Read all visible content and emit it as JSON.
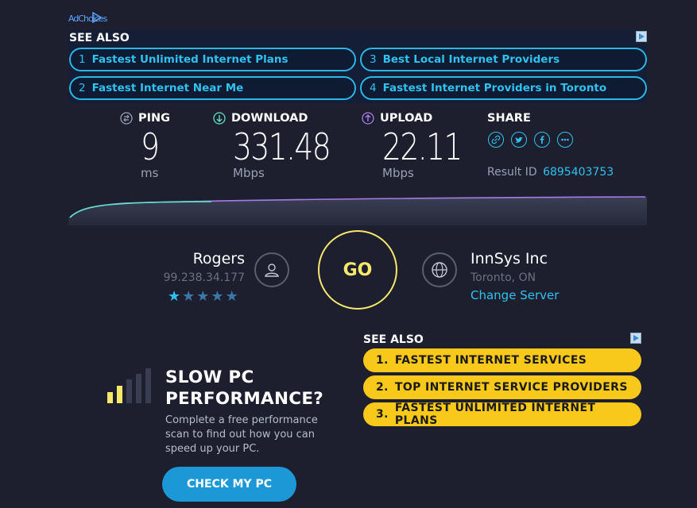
{
  "ad_top": {
    "adchoices_label": "AdChoices",
    "see_also": "SEE ALSO",
    "links": [
      {
        "num": "1",
        "label": "Fastest Unlimited Internet Plans"
      },
      {
        "num": "2",
        "label": "Fastest Internet Near Me"
      },
      {
        "num": "3",
        "label": "Best Local Internet Providers"
      },
      {
        "num": "4",
        "label": "Fastest Internet Providers in Toronto"
      }
    ]
  },
  "results": {
    "ping": {
      "label": "PING",
      "value": "9",
      "unit": "ms"
    },
    "download": {
      "label": "DOWNLOAD",
      "value": "331.48",
      "unit": "Mbps"
    },
    "upload": {
      "label": "UPLOAD",
      "value": "22.11",
      "unit": "Mbps"
    },
    "share_label": "SHARE",
    "share_icons": [
      "link-icon",
      "twitter-icon",
      "facebook-icon",
      "more-icon"
    ],
    "result_id_label": "Result ID",
    "result_id": "6895403753"
  },
  "isp": {
    "name": "Rogers",
    "ip": "99.238.34.177",
    "rating": 1,
    "rating_max": 5
  },
  "go_label": "GO",
  "server": {
    "name": "InnSys Inc",
    "location": "Toronto, ON",
    "change_label": "Change Server"
  },
  "promo": {
    "title_line1": "SLOW PC",
    "title_line2": "PERFORMANCE?",
    "body": "Complete a free performance scan to find out how you can speed up your PC.",
    "button": "CHECK MY PC"
  },
  "ad_bottom": {
    "see_also": "SEE ALSO",
    "links": [
      {
        "num": "1.",
        "label": "FASTEST INTERNET SERVICES"
      },
      {
        "num": "2.",
        "label": "TOP INTERNET SERVICE PROVIDERS"
      },
      {
        "num": "3.",
        "label": "FASTEST UNLIMITED INTERNET PLANS"
      }
    ]
  },
  "colors": {
    "background": "#1d1f2e",
    "accent_cyan": "#2fc2ef",
    "go_yellow": "#f5e86b",
    "ad_yellow": "#f8c81a",
    "button_blue": "#1c98d6",
    "download_line": "#5fe0c8",
    "upload_line": "#a77ce8"
  }
}
